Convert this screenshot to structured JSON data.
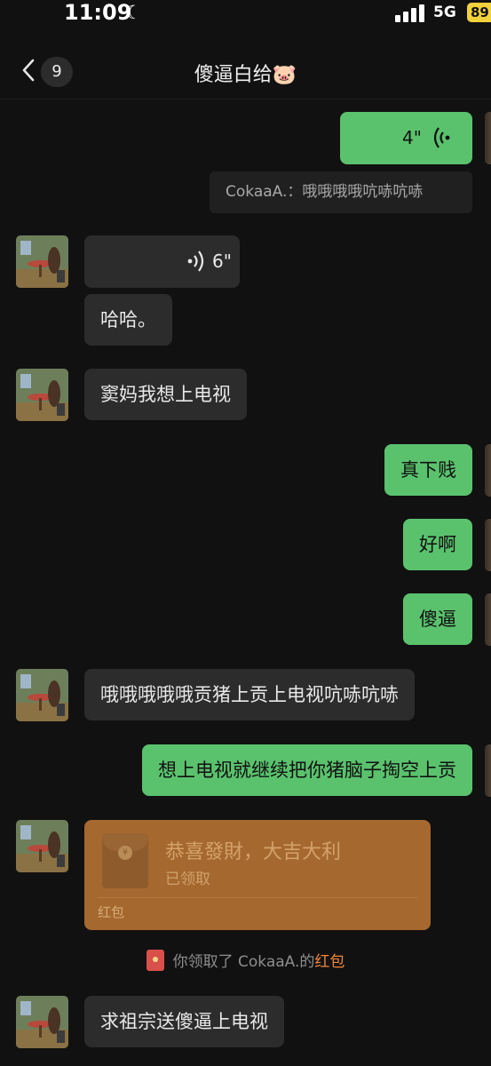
{
  "status_bar": {
    "time": "11:09",
    "network": "5G",
    "battery": "89"
  },
  "header": {
    "unread_count": "9",
    "title": "傻逼白给🐷"
  },
  "messages": {
    "m1": {
      "duration": "4\""
    },
    "m1_quote": "CokaaA.：哦哦哦哦吭哧吭哧",
    "m2": {
      "duration": "6\""
    },
    "m3": "哈哈。",
    "m4": "窦妈我想上电视",
    "m5": "真下贱",
    "m6": "好啊",
    "m7": "傻逼",
    "m8": "哦哦哦哦哦贡猪上贡上电视吭哧吭哧",
    "m9": "想上电视就继续把你猪脑子掏空上贡",
    "red_packet": {
      "title": "恭喜發財，大吉大利",
      "status": "已领取",
      "label": "红包"
    },
    "system": {
      "prefix": "你领取了 CokaaA.的",
      "link": "红包"
    },
    "m10": "求祖宗送傻逼上电视"
  }
}
